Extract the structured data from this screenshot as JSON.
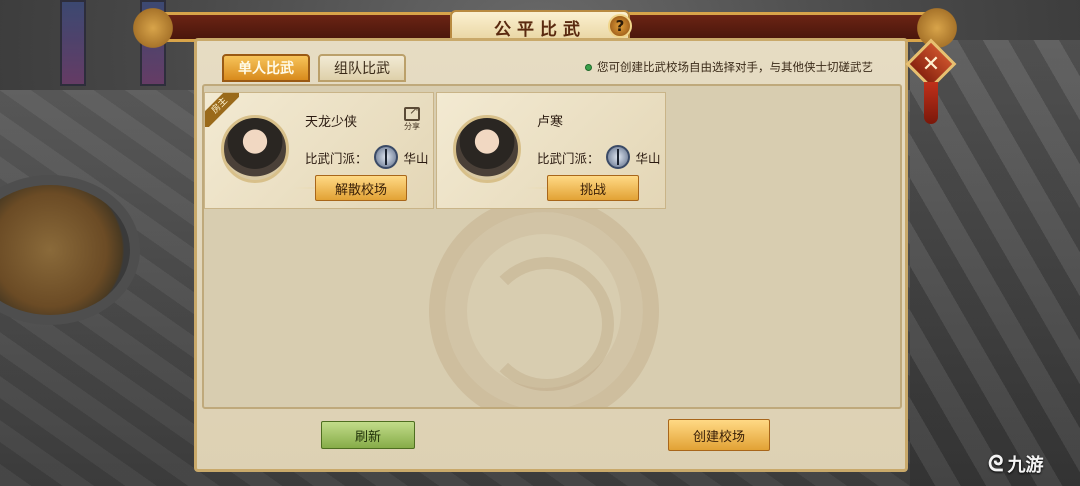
{
  "header": {
    "title": "公平比武",
    "help": "?"
  },
  "close": {
    "symbol": "✕"
  },
  "tabs": [
    {
      "label": "单人比武",
      "active": true
    },
    {
      "label": "组队比武",
      "active": false
    }
  ],
  "notice": "您可创建比武校场自由选择对手，与其他侠士切磋武艺",
  "cards": [
    {
      "badge": "房主",
      "name": "天龙少侠",
      "school_label": "比武门派：",
      "school": "华山",
      "share_label": "分享",
      "action": "解散校场"
    },
    {
      "name": "卢寒",
      "school_label": "比武门派：",
      "school": "华山",
      "action": "挑战"
    }
  ],
  "footer": {
    "refresh": "刷新",
    "create": "创建校场"
  },
  "watermark": {
    "mark": "ᘓ",
    "text": "九游"
  }
}
